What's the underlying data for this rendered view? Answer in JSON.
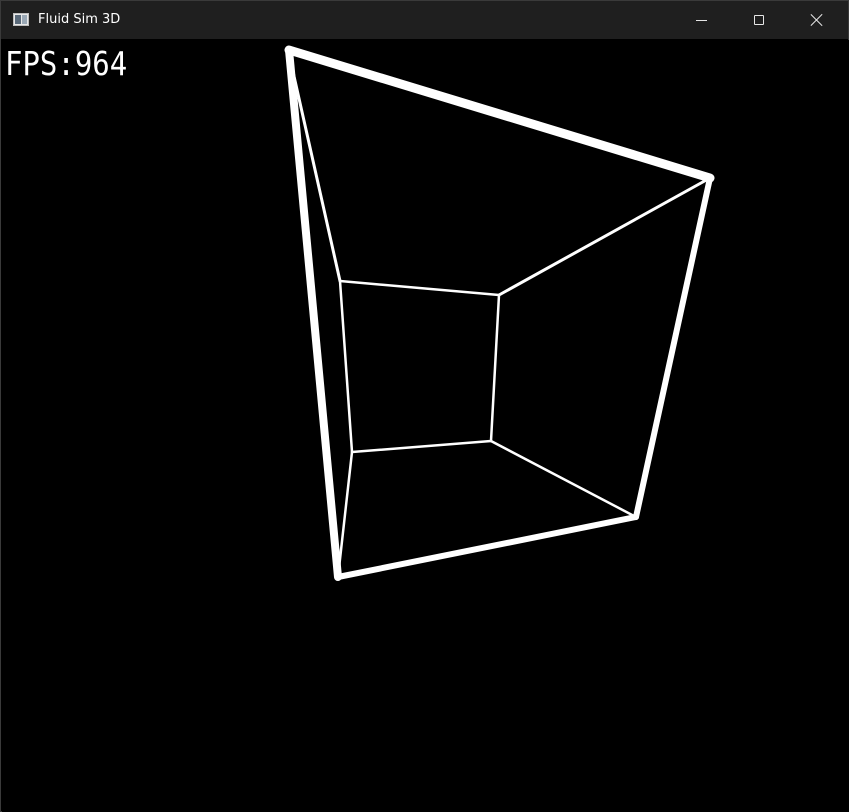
{
  "window": {
    "title": "Fluid Sim 3D",
    "icon": "app-window-icon",
    "controls": {
      "minimize": "minimize-icon",
      "maximize": "maximize-icon",
      "close": "close-icon"
    }
  },
  "overlay": {
    "fps_label": "FPS:",
    "fps_value": "964"
  },
  "colors": {
    "background": "#000000",
    "titlebar": "#1f1f1f",
    "wireframe": "#ffffff",
    "text": "#ffffff"
  }
}
